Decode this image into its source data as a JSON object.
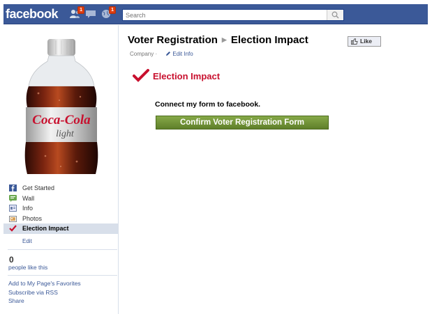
{
  "topbar": {
    "logo": "facebook",
    "friends_badge": "1",
    "notifications_badge": "1",
    "search_placeholder": "Search"
  },
  "sidebar": {
    "items": [
      {
        "label": "Get Started",
        "icon": "facebook-f-icon"
      },
      {
        "label": "Wall",
        "icon": "wall-icon"
      },
      {
        "label": "Info",
        "icon": "info-icon"
      },
      {
        "label": "Photos",
        "icon": "photos-icon"
      },
      {
        "label": "Election Impact",
        "icon": "checkmark-icon",
        "active": true
      }
    ],
    "edit_label": "Edit",
    "likes_count": "0",
    "likes_label": "people like this",
    "links": [
      "Add to My Page's Favorites",
      "Subscribe via RSS",
      "Share"
    ]
  },
  "profile_image": {
    "brand_line1": "Coca-Cola",
    "brand_line2": "light"
  },
  "main": {
    "title_part1": "Voter Registration",
    "title_part2": "Election Impact",
    "like_label": "Like",
    "category": "Company",
    "edit_info": "Edit Info",
    "app_title": "Election Impact",
    "connect_text": "Connect my form to facebook.",
    "confirm_button": "Confirm Voter Registration Form"
  },
  "colors": {
    "facebook_blue": "#3b5998",
    "app_red": "#c8102e",
    "button_green": "#6f9234",
    "active_nav": "#d8dfea"
  }
}
